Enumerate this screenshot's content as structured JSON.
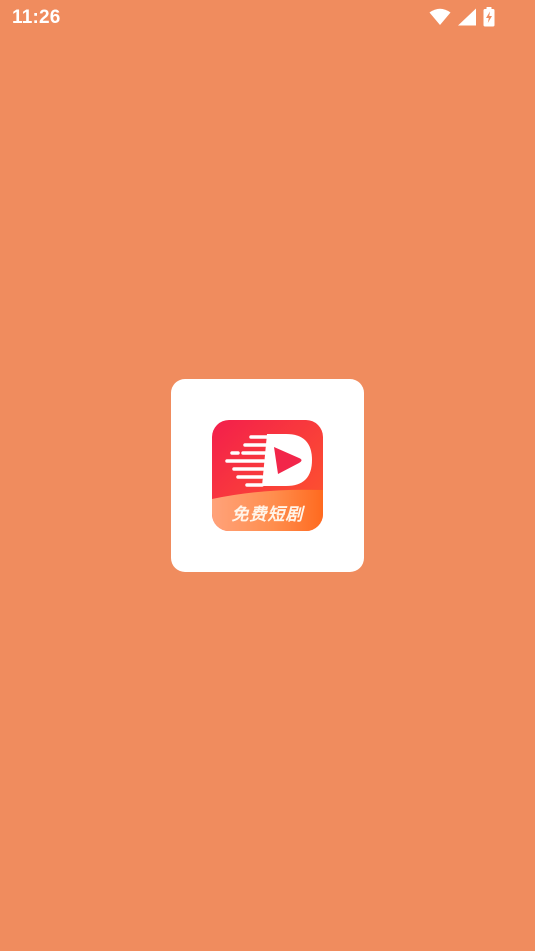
{
  "status_bar": {
    "time": "11:26",
    "icons": [
      "wifi-icon",
      "cellular-signal-icon",
      "battery-charging-icon"
    ]
  },
  "splash": {
    "logo_caption": "免费短剧",
    "colors": {
      "background": "#F08C5E",
      "card": "#FFFFFF",
      "logo_top": "#F0264A",
      "logo_bottom": "#FF8A3D"
    }
  }
}
